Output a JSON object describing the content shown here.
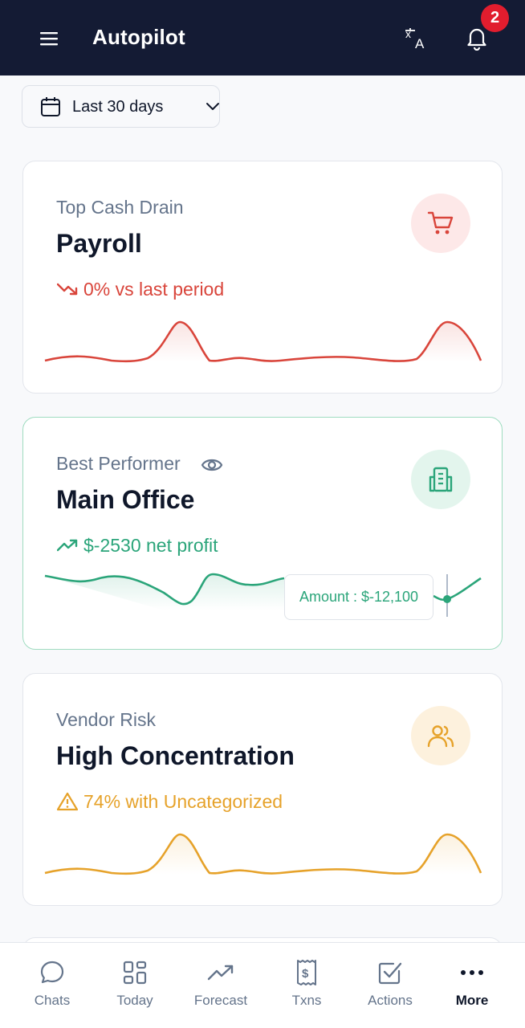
{
  "header": {
    "title": "Autopilot",
    "notification_count": "2"
  },
  "date_filter": {
    "label": "Last 30 days"
  },
  "cards": [
    {
      "subtitle": "Top Cash Drain",
      "title": "Payroll",
      "stat": "0% vs last period",
      "color": "#d9453b",
      "icon": "shopping-cart-icon",
      "trend": [
        0.2,
        0.25,
        0.2,
        0.35,
        1.0,
        0.25,
        0.3,
        0.25,
        0.3,
        0.35,
        0.25,
        0.3,
        1.0,
        0.05
      ]
    },
    {
      "subtitle": "Best Performer",
      "title": "Main Office",
      "stat": "$-2530 net profit",
      "color": "#2ba57a",
      "icon": "building-icon",
      "tooltip": "Amount : $-12,100"
    },
    {
      "subtitle": "Vendor Risk",
      "title": "High Concentration",
      "stat": "74% with Uncategorized",
      "color": "#e6a22a",
      "icon": "users-icon"
    }
  ],
  "nav": [
    {
      "label": "Chats",
      "icon": "chat-bubble-icon"
    },
    {
      "label": "Today",
      "icon": "grid-icon"
    },
    {
      "label": "Forecast",
      "icon": "trending-up-icon"
    },
    {
      "label": "Txns",
      "icon": "receipt-icon"
    },
    {
      "label": "Actions",
      "icon": "checkbox-icon"
    },
    {
      "label": "More",
      "icon": "more-dots-icon"
    }
  ]
}
